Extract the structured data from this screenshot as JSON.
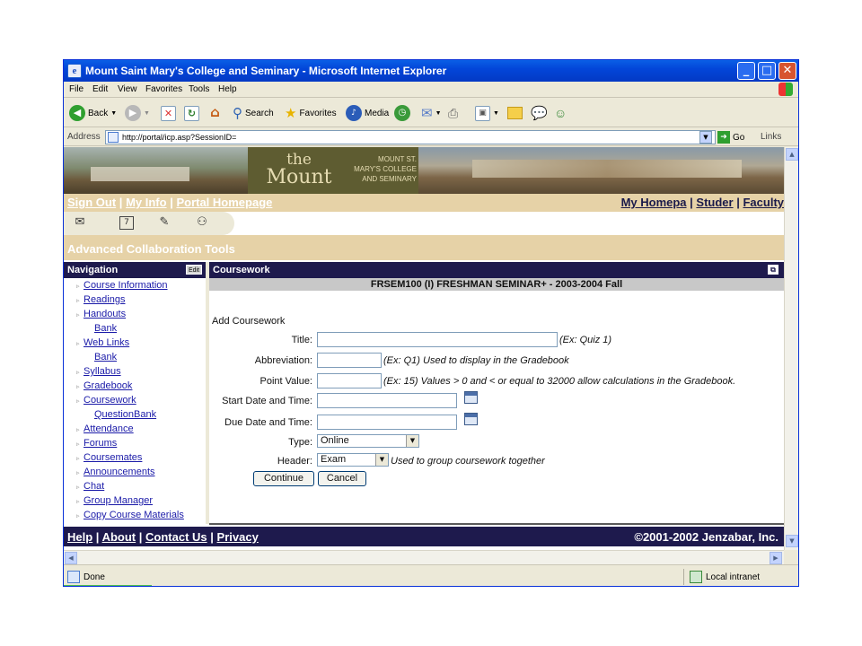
{
  "window": {
    "title": "Mount Saint Mary's College and Seminary - Microsoft Internet Explorer",
    "controls": {
      "minimize": "_",
      "maximize": "□",
      "close": "✕"
    }
  },
  "menu": [
    "File",
    "Edit",
    "View",
    "Favorites",
    "Tools",
    "Help"
  ],
  "toolbar": {
    "back_label": "Back",
    "search_label": "Search",
    "favorites_label": "Favorites",
    "media_label": "Media"
  },
  "address": {
    "label": "Address",
    "url": "http://portal/icp.asp?SessionID=",
    "go_label": "Go",
    "links_label": "Links"
  },
  "banner": {
    "logo_the": "the",
    "logo_mount": "Mount",
    "logo_sub_1": "MOUNT ST.",
    "logo_sub_2": "MARY'S COLLEGE",
    "logo_sub_3": "AND SEMINARY"
  },
  "top_links": {
    "sign_out": "Sign Out",
    "my_info": "My Info",
    "portal_homepage": "Portal Homepage",
    "my_homepage": "My Homepa",
    "students": "Studer",
    "faculty": "Faculty",
    "separator": "|"
  },
  "tool_title": "Advanced Collaboration Tools",
  "navigation": {
    "header": "Navigation",
    "edit_label": "Edit",
    "items": [
      {
        "label": "Course Information",
        "sub": false
      },
      {
        "label": "Readings",
        "sub": false
      },
      {
        "label": "Handouts",
        "sub": false
      },
      {
        "label": "Bank",
        "sub": true
      },
      {
        "label": "Web Links",
        "sub": false
      },
      {
        "label": "Bank",
        "sub": true
      },
      {
        "label": "Syllabus",
        "sub": false
      },
      {
        "label": "Gradebook",
        "sub": false
      },
      {
        "label": "Coursework",
        "sub": false
      },
      {
        "label": "QuestionBank",
        "sub": true
      },
      {
        "label": "Attendance",
        "sub": false
      },
      {
        "label": "Forums",
        "sub": false
      },
      {
        "label": "Coursemates",
        "sub": false
      },
      {
        "label": "Announcements",
        "sub": false
      },
      {
        "label": "Chat",
        "sub": false
      },
      {
        "label": "Group Manager",
        "sub": false
      },
      {
        "label": "Copy Course Materials",
        "sub": false
      }
    ]
  },
  "coursework": {
    "header": "Coursework",
    "course_title": "FRSEM100 (I) FRESHMAN SEMINAR+ - 2003-2004 Fall",
    "form": {
      "heading": "Add Coursework",
      "title_label": "Title:",
      "title_value": "",
      "title_hint": "(Ex: Quiz 1)",
      "abbrev_label": "Abbreviation:",
      "abbrev_value": "",
      "abbrev_hint": "(Ex: Q1) Used to display in the Gradebook",
      "points_label": "Point Value:",
      "points_value": "",
      "points_hint": "(Ex: 15) Values > 0 and < or equal to 32000 allow calculations in the Gradebook.",
      "start_label": "Start Date and Time:",
      "start_value": "",
      "due_label": "Due Date and Time:",
      "due_value": "",
      "type_label": "Type:",
      "type_value": "Online",
      "header_label": "Header:",
      "header_value": "Exam",
      "header_hint": "Used to group coursework together",
      "continue_label": "Continue",
      "cancel_label": "Cancel"
    }
  },
  "footer": {
    "help": "Help",
    "about": "About",
    "contact": "Contact Us",
    "privacy": "Privacy",
    "separator": "|",
    "copyright": "©2001-2002 Jenzabar, Inc."
  },
  "status": {
    "text": "Done",
    "zone": "Local intranet",
    "progress": 0.12
  },
  "colors": {
    "nav_header_bg": "#1e1a4d",
    "tan_bar": "#e6d2a7",
    "link": "#1a1aa8"
  }
}
